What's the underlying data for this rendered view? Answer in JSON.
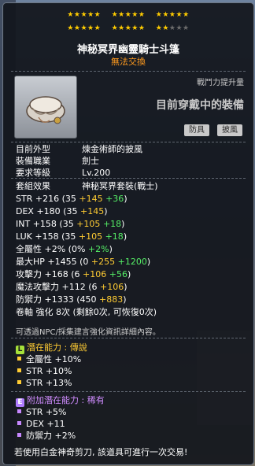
{
  "stars": {
    "row1": [
      "★★★★★",
      "★★★★★",
      "★★★★★"
    ],
    "row2_filled": [
      "★★★★★",
      "★★★★★",
      "★★"
    ],
    "row2_empty": "★★★"
  },
  "item": {
    "name": "神秘冥界幽靈騎士斗篷",
    "trade": "無法交換",
    "power_label": "戰鬥力提升量",
    "power_value": "目前穿戴中的裝備",
    "tags": [
      "防具",
      "披風"
    ]
  },
  "info": [
    {
      "k": "目前外型",
      "v": "煉金術師的披風"
    },
    {
      "k": "裝備職業",
      "v": "劍士"
    },
    {
      "k": "要求等級",
      "v": "Lv.200"
    }
  ],
  "set_effect": {
    "k": "套組效果",
    "v": "神秘冥界套裝(戰士)"
  },
  "stats": [
    {
      "name": "STR",
      "total": "+216",
      "base": "(35",
      "a": "+145",
      "b": "+36",
      "end": ")"
    },
    {
      "name": "DEX",
      "total": "+180",
      "base": "(35",
      "a": "+145",
      "b": "",
      "end": ")"
    },
    {
      "name": "INT",
      "total": "+158",
      "base": "(35",
      "a": "+105",
      "b": "+18",
      "end": ")"
    },
    {
      "name": "LUK",
      "total": "+158",
      "base": "(35",
      "a": "+105",
      "b": "+18",
      "end": ")"
    },
    {
      "name": "全屬性",
      "total": "+2%",
      "base": "(0%",
      "a": "",
      "b": "+2%",
      "end": ")"
    },
    {
      "name": "最大HP",
      "total": "+1455",
      "base": "(0",
      "a": "+255",
      "b": "+1200",
      "end": ")"
    },
    {
      "name": "攻擊力",
      "total": "+168",
      "base": "(6",
      "a": "+106",
      "b": "+56",
      "end": ")"
    },
    {
      "name": "魔法攻擊力",
      "total": "+112",
      "base": "(6",
      "a": "+106",
      "b": "",
      "end": ")"
    },
    {
      "name": "防禦力",
      "total": "+1333",
      "base": "(450",
      "a": "+883",
      "b": "",
      "end": ")"
    }
  ],
  "scroll": "卷軸 強化 8次 (剩餘0次, 可恢復0次)",
  "note": "可透過NPC/採集建言強化資訊詳細內容。",
  "potential": {
    "badge": "L",
    "label": "潛在能力 : 傳說",
    "lines": [
      "全屬性 +10%",
      "STR +10%",
      "STR +13%"
    ]
  },
  "additional": {
    "badge": "E",
    "label": "附加潛在能力 : 稀有",
    "lines": [
      "STR +5%",
      "DEX +11",
      "防禦力 +2%"
    ]
  },
  "footer": "若使用白金神奇剪刀, 該道具可進行一次交易!",
  "colors": {
    "accent_orange": "#ff9a1e",
    "star_gold": "#ffcc00",
    "legend_green": "#a6e03a",
    "epic_purple": "#b07cff"
  }
}
